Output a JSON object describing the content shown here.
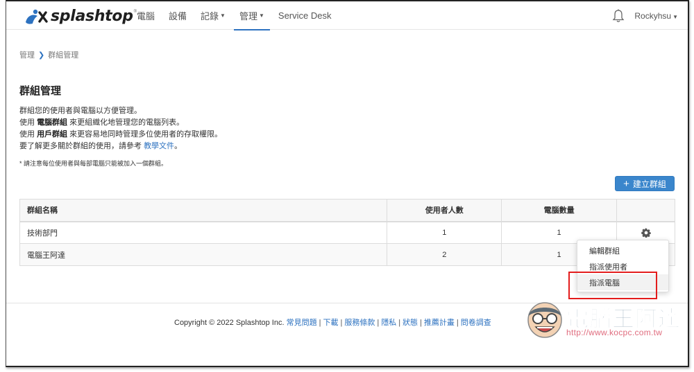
{
  "brand": {
    "name": "splashtop",
    "accent": "#2d72c0",
    "button_color": "#3a86cc"
  },
  "nav": {
    "items": [
      {
        "label": "電腦",
        "caret": false,
        "active": false
      },
      {
        "label": "設備",
        "caret": false,
        "active": false
      },
      {
        "label": "記錄",
        "caret": true,
        "active": false
      },
      {
        "label": "管理",
        "caret": true,
        "active": true
      },
      {
        "label": "Service Desk",
        "caret": false,
        "active": false
      }
    ],
    "notification_icon": "bell-icon",
    "user": "Rockyhsu"
  },
  "breadcrumb": {
    "parent": "管理",
    "separator": ">",
    "current": "群組管理"
  },
  "page": {
    "title": "群組管理",
    "desc": {
      "line1": "群組您的使用者與電腦以方便管理。",
      "line2_pre": "使用 ",
      "line2_bold": "電腦群組",
      "line2_post": " 來更組織化地管理您的電腦列表。",
      "line3_pre": "使用 ",
      "line3_bold": "用戶群組",
      "line3_post": " 來更容易地同時管理多位使用者的存取權限。",
      "line4_pre": "要了解更多關於群組的使用，請參考 ",
      "line4_link": "教學文件",
      "line4_post": "。"
    },
    "note": "* 請注意每位使用者與每部電腦只能被加入一個群組。",
    "create_button": {
      "icon": "plus-icon",
      "label": "建立群組"
    }
  },
  "table": {
    "headers": [
      "群組名稱",
      "使用者人數",
      "電腦數量",
      ""
    ],
    "rows": [
      {
        "name": "技術部門",
        "users": "1",
        "computers": "1"
      },
      {
        "name": "電腦王阿達",
        "users": "2",
        "computers": "1"
      }
    ]
  },
  "dropdown": {
    "items": [
      "編輯群組",
      "指派使用者",
      "指派電腦"
    ],
    "highlighted_index": 2
  },
  "footer": {
    "copyright": "Copyright © 2022 Splashtop Inc.",
    "links": [
      "常見問題",
      "下載",
      "服務條款",
      "隱私",
      "狀態",
      "推薦計畫",
      "問卷調查"
    ]
  },
  "watermark": {
    "title": "電腦王阿達",
    "url": "http://www.kocpc.com.tw"
  }
}
